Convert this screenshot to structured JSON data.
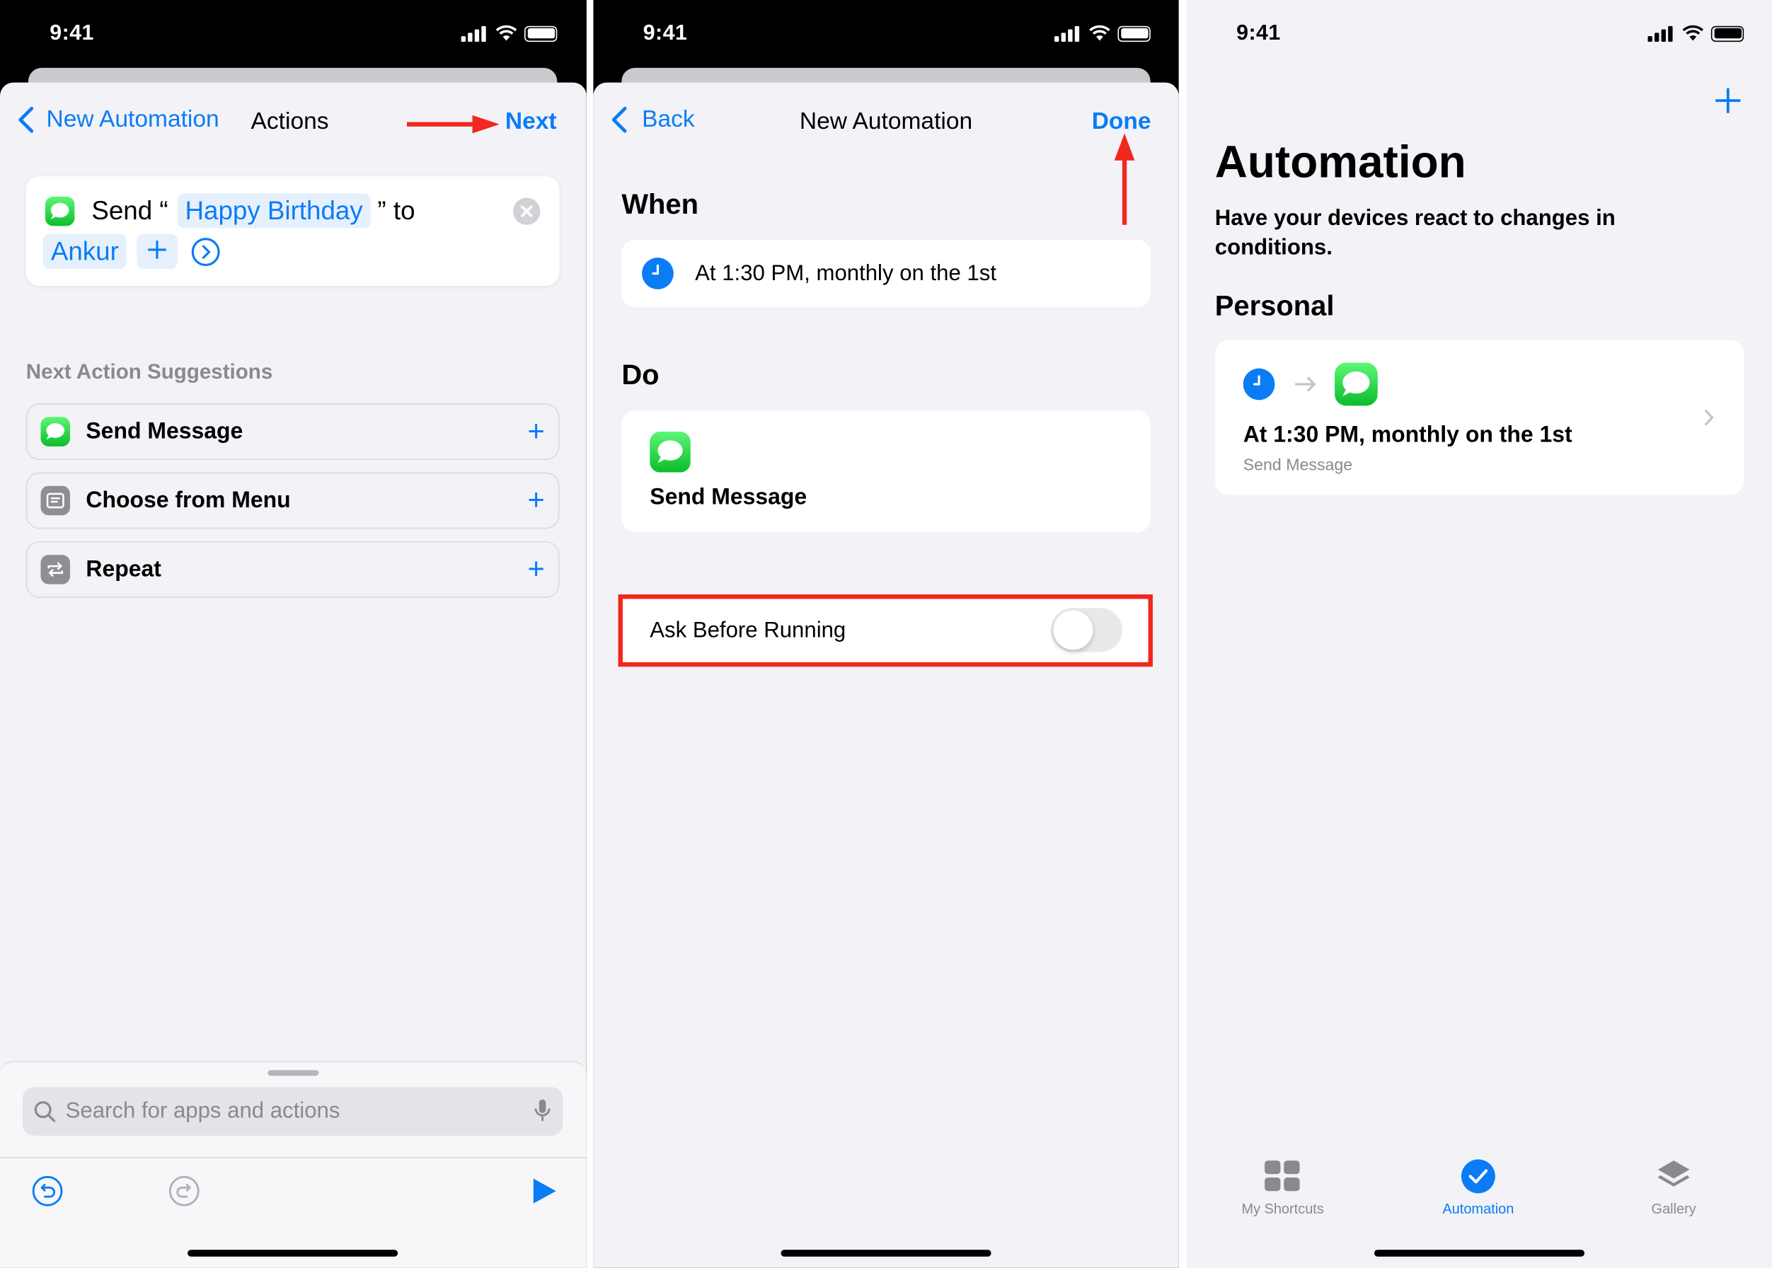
{
  "status": {
    "time": "9:41"
  },
  "screen1": {
    "back_label": "New Automation",
    "title": "Actions",
    "next_label": "Next",
    "action": {
      "prefix": "Send “",
      "message": "Happy Birthday",
      "suffix": "” to",
      "recipient": "Ankur"
    },
    "suggestions_header": "Next Action Suggestions",
    "suggestions": [
      {
        "label": "Send Message",
        "icon": "messages-icon"
      },
      {
        "label": "Choose from Menu",
        "icon": "menu-icon"
      },
      {
        "label": "Repeat",
        "icon": "repeat-icon"
      }
    ],
    "search_placeholder": "Search for apps and actions"
  },
  "screen2": {
    "back_label": "Back",
    "title": "New Automation",
    "done_label": "Done",
    "when_header": "When",
    "trigger": "At 1:30 PM, monthly on the 1st",
    "do_header": "Do",
    "action_label": "Send Message",
    "ask_label": "Ask Before Running",
    "ask_enabled": false
  },
  "screen3": {
    "title": "Automation",
    "subtitle": "Have your devices react to changes in conditions.",
    "section": "Personal",
    "item_title": "At 1:30 PM, monthly on the 1st",
    "item_subtitle": "Send Message",
    "tabs": [
      {
        "label": "My Shortcuts",
        "active": false
      },
      {
        "label": "Automation",
        "active": true
      },
      {
        "label": "Gallery",
        "active": false
      }
    ]
  },
  "colors": {
    "accent": "#0a7cf5",
    "annotation": "#f0281e",
    "background": "#f2f2f7"
  }
}
